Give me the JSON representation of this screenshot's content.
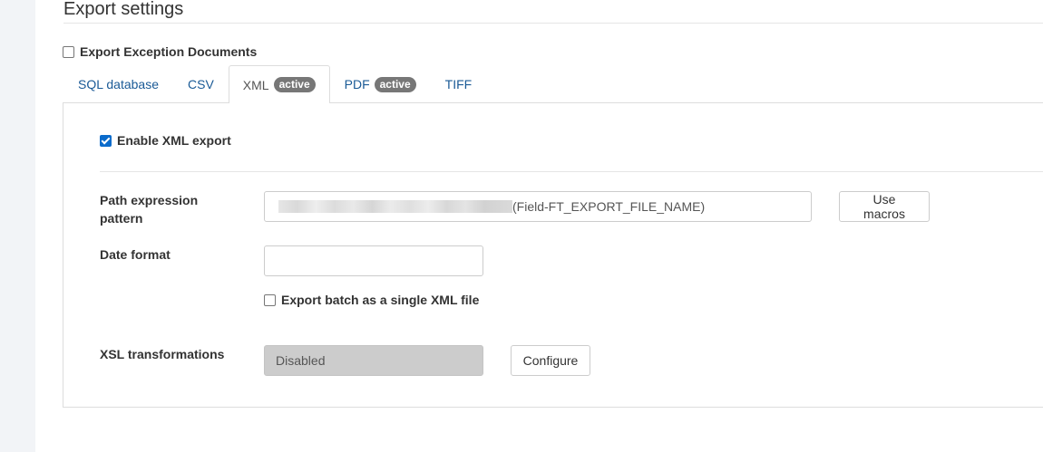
{
  "page": {
    "title": "Export settings"
  },
  "export_exception": {
    "label": "Export Exception Documents",
    "checked": false
  },
  "tabs": [
    {
      "label": "SQL database",
      "badge": "",
      "active": false
    },
    {
      "label": "CSV",
      "badge": "",
      "active": false
    },
    {
      "label": "XML",
      "badge": "active",
      "active": true
    },
    {
      "label": "PDF",
      "badge": "active",
      "active": false
    },
    {
      "label": "TIFF",
      "badge": "",
      "active": false
    }
  ],
  "xml_panel": {
    "enable_label": "Enable XML export",
    "enable_checked": true,
    "path_label": "Path expression pattern",
    "path_value_visible": "(Field-FT_EXPORT_FILE_NAME)",
    "use_macros_label": "Use macros",
    "date_format_label": "Date format",
    "date_format_value": "",
    "batch_label": "Export batch as a single XML file",
    "batch_checked": false,
    "xsl_label": "XSL transformations",
    "xsl_value": "Disabled",
    "configure_label": "Configure"
  },
  "colors": {
    "link": "#1a5a96",
    "badge": "#777777",
    "checkbox_checked": "#0b6bcb",
    "disabled_input": "#cccccc"
  }
}
